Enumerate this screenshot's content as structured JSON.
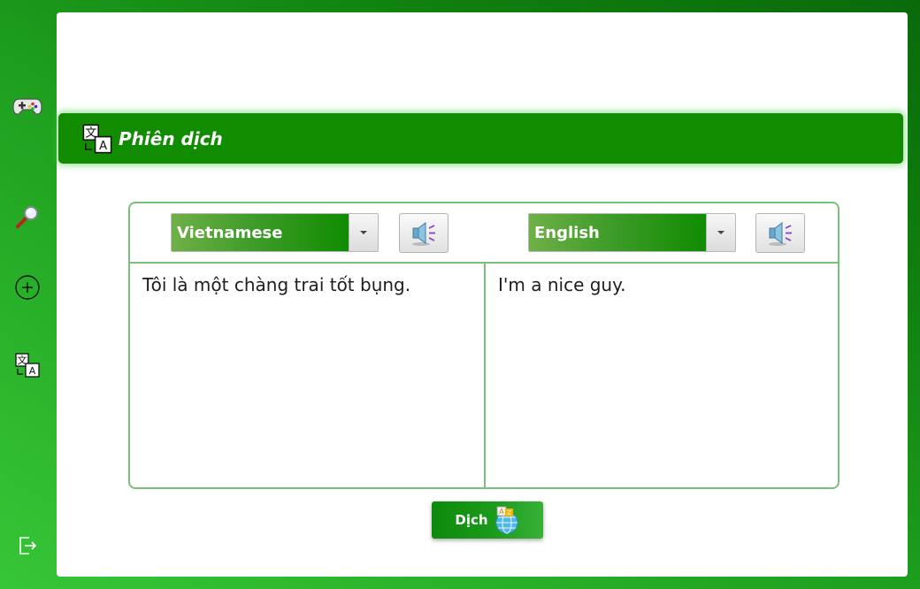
{
  "sidebar": {
    "items": [
      {
        "icon": "gamepad-icon"
      },
      {
        "icon": "search-icon"
      },
      {
        "icon": "add-circle-icon"
      },
      {
        "icon": "translate-icon"
      },
      {
        "icon": "logout-icon"
      }
    ]
  },
  "header": {
    "title": "Phiên dịch",
    "icon": "translate-icon"
  },
  "source": {
    "language": "Vietnamese",
    "text": "Tôi là một chàng trai tốt bụng."
  },
  "target": {
    "language": "English",
    "text": "I'm a nice guy."
  },
  "translate_button": {
    "label": "Dịch",
    "icon": "globe-translate-icon"
  },
  "colors": {
    "accent": "#118b00",
    "border": "#79c079",
    "background": "#1fa11f"
  }
}
